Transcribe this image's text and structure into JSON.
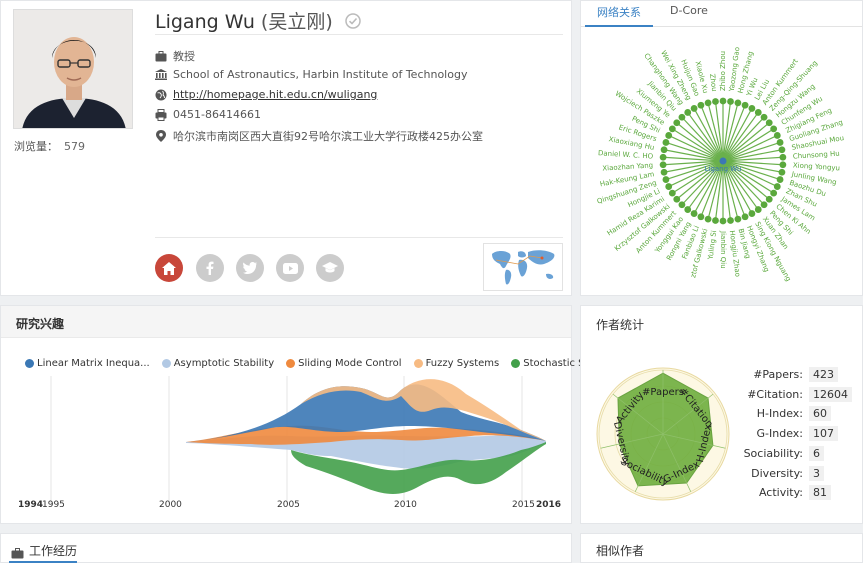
{
  "profile": {
    "name": "Ligang Wu",
    "name_cn": "(吴立刚)",
    "views_label": "浏览量：",
    "views_count": "579",
    "title": "教授",
    "affiliation": "School of Astronautics, Harbin Institute of Technology",
    "homepage": "http://homepage.hit.edu.cn/wuligang",
    "phone": "0451-86414661",
    "address": "哈尔滨市南岗区西大直街92号哈尔滨工业大学行政楼425办公室"
  },
  "tabs": {
    "network": "网络关系",
    "dcore": "D-Core"
  },
  "network": {
    "center": "Ligang Wu",
    "nodes": [
      "Zhibo Zhou",
      "Yaozong Gao",
      "Hong Zhang",
      "Yi Wu",
      "Lei Liu",
      "Anton Kummert",
      "Zeng-Qing-Shuang",
      "Hongzu Wang",
      "Chunfeng Wu",
      "Zhigiang Feng",
      "Guoliang Zhang",
      "Shaoshuai Mou",
      "Chunsong Hu",
      "Xiong Yongyu",
      "Junling Wang",
      "Baozhu Du",
      "Zhan Shu",
      "James Lam",
      "Chen Ki Ahn",
      "Peng Shi",
      "Xuan Zhan",
      "Sing Kiong Nguang",
      "Hongyi Zhang",
      "Bin Jiang",
      "Hongjiu Zhao",
      "Jianbin Qiu",
      "Yuling Si",
      "ztof Galkowski",
      "Fanbiao Li",
      "Rongni Yang",
      "Yonggui Kao",
      "Anton Kummert",
      "Krzysztof Galkowski",
      "Hamid Reza Karimi",
      "Hongjie Li",
      "Qingshuang Zeng",
      "Hak-Keung Lam",
      "Xiaozhan Yang",
      "Daniel W. C. HO",
      "Xiaoxiang Hu",
      "Eric Rogers",
      "Peng Shi",
      "Wojciech Paszke",
      "Xiumeng Ye",
      "Jianbin Qiu",
      "Changhong Wang",
      "Wei Xing Zheng",
      "Huijun Gao",
      "Xiaole Xu",
      "Zhou"
    ]
  },
  "interests": {
    "title": "研究兴趣",
    "legend": [
      {
        "label": "Linear Matrix Inequa...",
        "color": "#3b78b5"
      },
      {
        "label": "Asymptotic Stability",
        "color": "#b2c9e4"
      },
      {
        "label": "Sliding Mode Control",
        "color": "#ef8a3e"
      },
      {
        "label": "Fuzzy Systems",
        "color": "#f7bb83"
      },
      {
        "label": "Stochastic Systems",
        "color": "#43a04a"
      }
    ],
    "axis": {
      "start": "1994",
      "ticks": [
        "1995",
        "2000",
        "2005",
        "2010",
        "2015"
      ],
      "end": "2016"
    }
  },
  "stats": {
    "title": "作者统计",
    "radar_labels": [
      "#Papers",
      "#Citation",
      "H-Index",
      "G-Index",
      "Sociability",
      "Diversity",
      "Activity"
    ],
    "rows": [
      {
        "label": "#Papers:",
        "value": "423"
      },
      {
        "label": "#Citation:",
        "value": "12604"
      },
      {
        "label": "H-Index:",
        "value": "60"
      },
      {
        "label": "G-Index:",
        "value": "107"
      },
      {
        "label": "Sociability:",
        "value": "6"
      },
      {
        "label": "Diversity:",
        "value": "3"
      },
      {
        "label": "Activity:",
        "value": "81"
      }
    ]
  },
  "sections": {
    "career": "工作经历",
    "similar": "相似作者"
  }
}
